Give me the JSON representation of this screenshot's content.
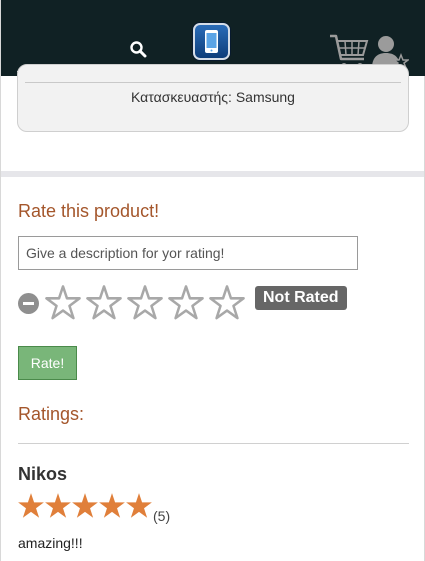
{
  "header": {
    "search": {
      "value": "",
      "placeholder": ""
    },
    "icons": {
      "search": "search-icon",
      "logo": "mobile-phone-logo-icon",
      "cart": "shopping-cart-icon",
      "user": "user-star-icon"
    }
  },
  "product": {
    "manufacturer_text": "Κατασκευαστής: Samsung"
  },
  "rate_section": {
    "title": "Rate this product!",
    "description": {
      "value": "",
      "placeholder": "Give a description for yor rating!"
    },
    "star_count": 5,
    "selected_rating": 0,
    "status_badge": "Not Rated",
    "submit_label": "Rate!"
  },
  "ratings_section": {
    "title": "Ratings:",
    "reviews": [
      {
        "name": "Nikos",
        "stars": 5,
        "count_text": "(5)",
        "comment": "amazing!!!"
      }
    ]
  },
  "colors": {
    "header_bg": "#102124",
    "accent": "#a4562b",
    "star_filled": "#e07f3a",
    "star_empty_outline": "#a8a8a8",
    "rate_button": "#79b679",
    "badge": "#666666"
  }
}
